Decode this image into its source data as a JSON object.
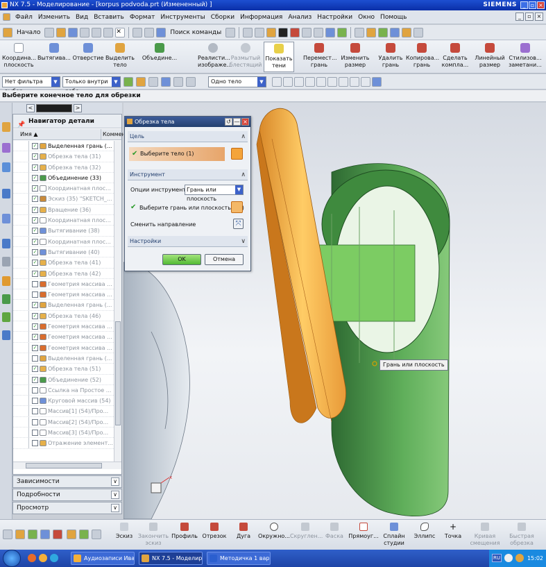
{
  "window": {
    "title": "NX 7.5 - Моделирование - [korpus podvoda.prt (Измененный) ]",
    "brand": "SIEMENS"
  },
  "menu": [
    "Файл",
    "Изменить",
    "Вид",
    "Вставить",
    "Формат",
    "Инструменты",
    "Сборки",
    "Информация",
    "Анализ",
    "Настройки",
    "Окно",
    "Помощь"
  ],
  "std_toolbar": {
    "start_label": "Начало",
    "search_label": "Поиск команды"
  },
  "feature_toolbar": [
    {
      "label": "Координа... плоскость",
      "disabled": false
    },
    {
      "label": "Вытягива...",
      "disabled": false
    },
    {
      "label": "Отверстие",
      "disabled": false
    },
    {
      "label": "Выделить тело",
      "disabled": false
    },
    {
      "label": "Объедине...",
      "disabled": false
    },
    {
      "label": "Реалисти... изображе...",
      "disabled": false
    },
    {
      "label": "Размытый блестящий",
      "disabled": true
    },
    {
      "label": "Показать тени",
      "disabled": false
    },
    {
      "label": "Перемест... грань",
      "disabled": false
    },
    {
      "label": "Изменить размер",
      "disabled": false
    },
    {
      "label": "Удалить грань",
      "disabled": false
    },
    {
      "label": "Копирова... грань",
      "disabled": false
    },
    {
      "label": "Сделать компла...",
      "disabled": false
    },
    {
      "label": "Линейный размер",
      "disabled": false
    },
    {
      "label": "Стилизов... заметани...",
      "disabled": false
    }
  ],
  "selection_bar": {
    "filter": "Нет фильтра выбор",
    "scope": "Только внутри рабо",
    "body": "Одно тело"
  },
  "cue_line": "Выберите конечное тело для обрезки",
  "navigator": {
    "title": "Навигатор детали",
    "col_name": "Имя",
    "col_comment": "Коммен",
    "rows": [
      {
        "label": "Выделенная грань (...",
        "checked": true,
        "dim": false,
        "color": "#e0a440"
      },
      {
        "label": "Обрезка тела (31)",
        "checked": true,
        "dim": true,
        "color": "#e6b04a"
      },
      {
        "label": "Обрезка тела (32)",
        "checked": true,
        "dim": true,
        "color": "#e6b04a"
      },
      {
        "label": "Объединение (33)",
        "checked": true,
        "dim": false,
        "color": "#4a9a4a"
      },
      {
        "label": "Координатная плос...",
        "checked": true,
        "dim": true,
        "color": "#ffffff"
      },
      {
        "label": "Эскиз (35) \"SKETCH_...",
        "checked": true,
        "dim": true,
        "color": "#c98a3a"
      },
      {
        "label": "Вращение (36)",
        "checked": true,
        "dim": true,
        "color": "#e6b04a"
      },
      {
        "label": "Координатная плос...",
        "checked": true,
        "dim": true,
        "color": "#ffffff"
      },
      {
        "label": "Вытягивание (38)",
        "checked": true,
        "dim": true,
        "color": "#6e90d8"
      },
      {
        "label": "Координатная плос...",
        "checked": true,
        "dim": true,
        "color": "#ffffff"
      },
      {
        "label": "Вытягивание (40)",
        "checked": true,
        "dim": true,
        "color": "#6e90d8"
      },
      {
        "label": "Обрезка тела (41)",
        "checked": true,
        "dim": true,
        "color": "#e6b04a"
      },
      {
        "label": "Обрезка тела (42)",
        "checked": true,
        "dim": true,
        "color": "#e6b04a"
      },
      {
        "label": "Геометрия массива ...",
        "checked": false,
        "dim": true,
        "color": "#d96d2e"
      },
      {
        "label": "Геометрия массива ...",
        "checked": false,
        "dim": true,
        "color": "#d96d2e"
      },
      {
        "label": "Выделенная грань (...",
        "checked": true,
        "dim": true,
        "color": "#e0a440"
      },
      {
        "label": "Обрезка тела (46)",
        "checked": true,
        "dim": true,
        "color": "#e6b04a"
      },
      {
        "label": "Геометрия массива ...",
        "checked": true,
        "dim": true,
        "color": "#d96d2e"
      },
      {
        "label": "Геометрия массива ...",
        "checked": true,
        "dim": true,
        "color": "#d96d2e"
      },
      {
        "label": "Геометрия массива ...",
        "checked": true,
        "dim": true,
        "color": "#d96d2e"
      },
      {
        "label": "Выделенная грань (...",
        "checked": false,
        "dim": true,
        "color": "#e0a440"
      },
      {
        "label": "Обрезка тела (51)",
        "checked": true,
        "dim": true,
        "color": "#e6b04a"
      },
      {
        "label": "Объединение (52)",
        "checked": true,
        "dim": true,
        "color": "#4a9a4a"
      },
      {
        "label": "Ссылка на Простое ...",
        "checked": false,
        "dim": true,
        "color": "#ffffff"
      },
      {
        "label": "Круговой массив (54)",
        "checked": false,
        "dim": true,
        "color": "#6e90d8"
      },
      {
        "label": "Массив[1] (54)/Про...",
        "checked": false,
        "dim": true,
        "color": "#ffffff"
      },
      {
        "label": "Массив[2] (54)/Про...",
        "checked": false,
        "dim": true,
        "color": "#ffffff"
      },
      {
        "label": "Массив[3] (54)/Про...",
        "checked": false,
        "dim": true,
        "color": "#ffffff"
      },
      {
        "label": "Отражение элемент...",
        "checked": false,
        "dim": true,
        "color": "#e6b04a"
      }
    ],
    "sections": [
      "Зависимости",
      "Подробности",
      "Просмотр"
    ]
  },
  "dialog": {
    "title": "Обрезка тела",
    "group_target": "Цель",
    "select_body": "Выберите тело (1)",
    "group_tool": "Инструмент",
    "tool_options_label": "Опции инструмента",
    "tool_options_value": "Грань или плоскость",
    "select_face": "Выберите грань или плоскость (26)",
    "reverse_label": "Сменить направление",
    "group_settings": "Настройки",
    "ok": "OK",
    "cancel": "Отмена"
  },
  "tooltip": "Грань или плоскость",
  "bottom_toolbar": [
    {
      "label": "Эскиз",
      "disabled": false
    },
    {
      "label": "Закончить эскиз",
      "disabled": true
    },
    {
      "label": "Профиль",
      "disabled": false
    },
    {
      "label": "Отрезок",
      "disabled": false
    },
    {
      "label": "Дуга",
      "disabled": false
    },
    {
      "label": "Окружно...",
      "disabled": false
    },
    {
      "label": "Скруглен...",
      "disabled": true
    },
    {
      "label": "Фаска",
      "disabled": true
    },
    {
      "label": "Прямоуг...",
      "disabled": false
    },
    {
      "label": "Сплайн студии",
      "disabled": false
    },
    {
      "label": "Эллипс",
      "disabled": false
    },
    {
      "label": "Точка",
      "disabled": false
    },
    {
      "label": "Кривая смещения",
      "disabled": true
    },
    {
      "label": "Быстрая обрезка",
      "disabled": true
    }
  ],
  "taskbar": {
    "tasks": [
      {
        "label": "Аудиозаписи Иван...",
        "active": false
      },
      {
        "label": "NX 7.5 - Моделиро...",
        "active": true
      },
      {
        "label": "Методичка 1 вариа...",
        "active": false
      }
    ],
    "lang": "RU",
    "clock": "15:02"
  }
}
